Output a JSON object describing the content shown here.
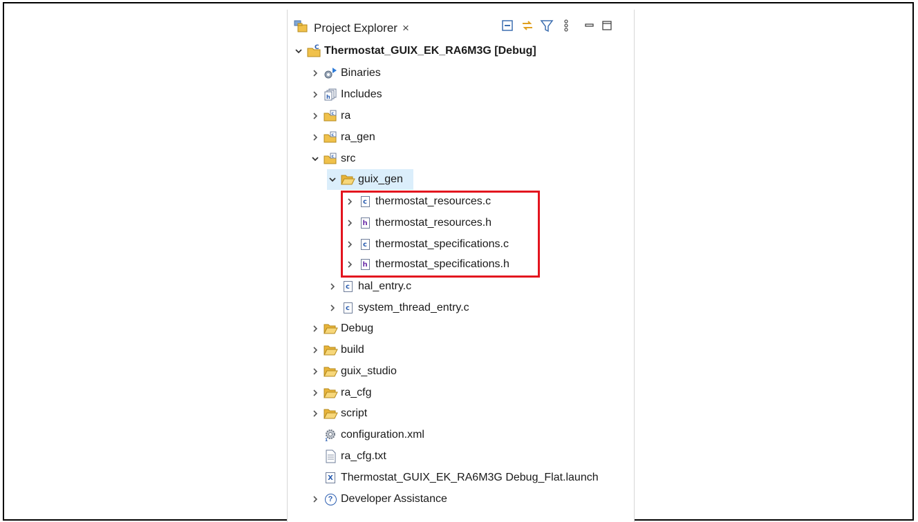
{
  "panel": {
    "tab_title": "Project Explorer",
    "tab_close": "×",
    "toolbar": [
      {
        "name": "collapse-all-icon"
      },
      {
        "name": "link-with-editor-icon"
      },
      {
        "name": "filter-icon"
      },
      {
        "name": "view-menu-icon"
      },
      {
        "name": "minimize-icon"
      },
      {
        "name": "maximize-icon"
      }
    ]
  },
  "tree": {
    "project": "Thermostat_GUIX_EK_RA6M3G [Debug]",
    "binaries": "Binaries",
    "includes": "Includes",
    "ra": "ra",
    "ra_gen": "ra_gen",
    "src": "src",
    "guix_gen": "guix_gen",
    "thermostat_resources_c": "thermostat_resources.c",
    "thermostat_resources_h": "thermostat_resources.h",
    "thermostat_specifications_c": "thermostat_specifications.c",
    "thermostat_specifications_h": "thermostat_specifications.h",
    "hal_entry_c": "hal_entry.c",
    "system_thread_entry_c": "system_thread_entry.c",
    "debug": "Debug",
    "build": "build",
    "guix_studio": "guix_studio",
    "ra_cfg": "ra_cfg",
    "script": "script",
    "configuration_xml": "configuration.xml",
    "ra_cfg_txt": "ra_cfg.txt",
    "launch_file": "Thermostat_GUIX_EK_RA6M3G Debug_Flat.launch",
    "developer_assistance": "Developer Assistance"
  },
  "glyphs": {
    "c": "c",
    "h": "h",
    "x": "X",
    "help": "?"
  },
  "colors": {
    "highlight_border": "#e3141e",
    "selection": "#dbeefb",
    "folder": "#f0c14b"
  }
}
